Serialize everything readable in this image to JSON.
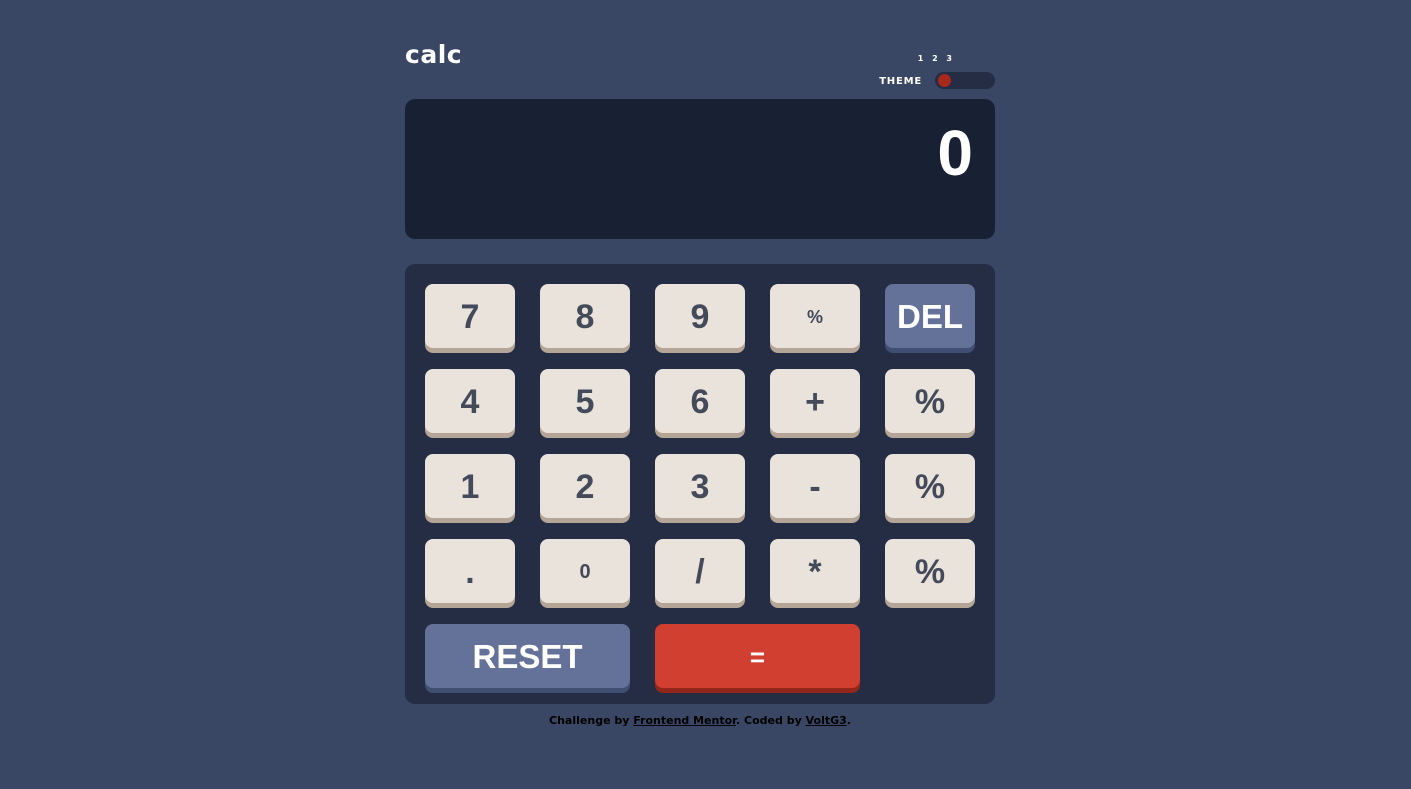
{
  "header": {
    "logo": "calc",
    "theme_label": "THEME",
    "theme_numbers": "1 2 3",
    "theme_selected": 1
  },
  "display": {
    "value": "0"
  },
  "keys": {
    "row1": [
      "7",
      "8",
      "9",
      "%",
      "DEL"
    ],
    "row2": [
      "4",
      "5",
      "6",
      "+",
      "%"
    ],
    "row3": [
      "1",
      "2",
      "3",
      "-",
      "%"
    ],
    "row4": [
      ".",
      "0",
      "/",
      "*",
      "%"
    ],
    "reset": "RESET",
    "equals": "="
  },
  "footer": {
    "prefix": "Challenge by ",
    "link1": "Frontend Mentor",
    "middle": ". Coded by ",
    "link2": "VoltG3",
    "suffix": "."
  },
  "colors": {
    "background": "#3a4764",
    "screen": "#182034",
    "keypad": "#242d44",
    "key": "#eae3dc",
    "key_shadow": "#b4a597",
    "accent_key": "#647198",
    "equals_key": "#d03f2f",
    "toggle_knob": "#a8281c"
  }
}
